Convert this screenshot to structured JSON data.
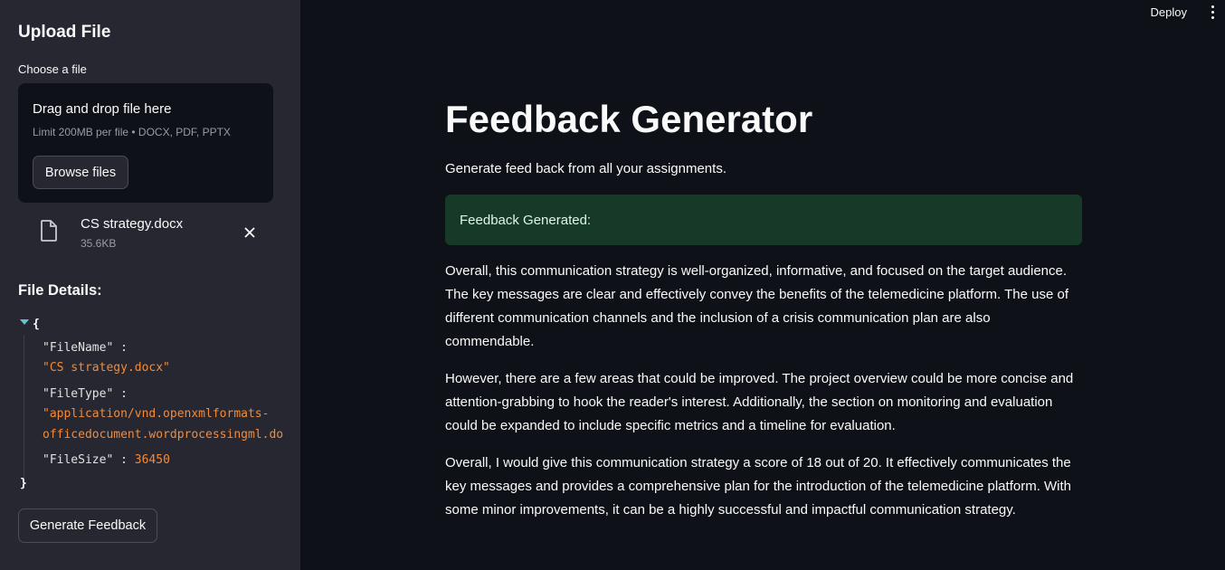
{
  "sidebar": {
    "title": "Upload File",
    "uploader_label": "Choose a file",
    "dropzone": {
      "title": "Drag and drop file here",
      "limit": "Limit 200MB per file • DOCX, PDF, PPTX",
      "browse_label": "Browse files"
    },
    "uploaded_file": {
      "name": "CS strategy.docx",
      "size": "35.6KB"
    },
    "file_details_title": "File Details:",
    "json_viewer": {
      "open_brace": "{",
      "close_brace": "}",
      "entries": [
        {
          "key": "\"FileName\"",
          "value": "\"CS strategy.docx\""
        },
        {
          "key": "\"FileType\"",
          "value_line1": "\"application/vnd.openxmlformats-",
          "value_line2": "officedocument.wordprocessingml.do"
        },
        {
          "key": "\"FileSize\"",
          "value": "36450"
        }
      ],
      "colon": ":"
    },
    "generate_label": "Generate Feedback"
  },
  "header": {
    "deploy_label": "Deploy"
  },
  "main": {
    "title": "Feedback Generator",
    "subtitle": "Generate feed back from all your assignments.",
    "success_message": "Feedback Generated:",
    "paragraphs": [
      "Overall, this communication strategy is well-organized, informative, and focused on the target audience. The key messages are clear and effectively convey the benefits of the telemedicine platform. The use of different communication channels and the inclusion of a crisis communication plan are also commendable.",
      "However, there are a few areas that could be improved. The project overview could be more concise and attention-grabbing to hook the reader's interest. Additionally, the section on monitoring and evaluation could be expanded to include specific metrics and a timeline for evaluation.",
      "Overall, I would give this communication strategy a score of 18 out of 20. It effectively communicates the key messages and provides a comprehensive plan for the introduction of the telemedicine platform. With some minor improvements, it can be a highly successful and impactful communication strategy."
    ]
  },
  "colors": {
    "sidebar_bg": "#262730",
    "main_bg": "#0e1117",
    "success_bg": "#173928",
    "json_string": "#f28b3b",
    "toggle": "#5ec4d8"
  },
  "icons": {
    "file": "file-icon",
    "close": "close-icon",
    "menu": "more-vertical-icon",
    "toggle": "collapse-triangle-icon"
  }
}
